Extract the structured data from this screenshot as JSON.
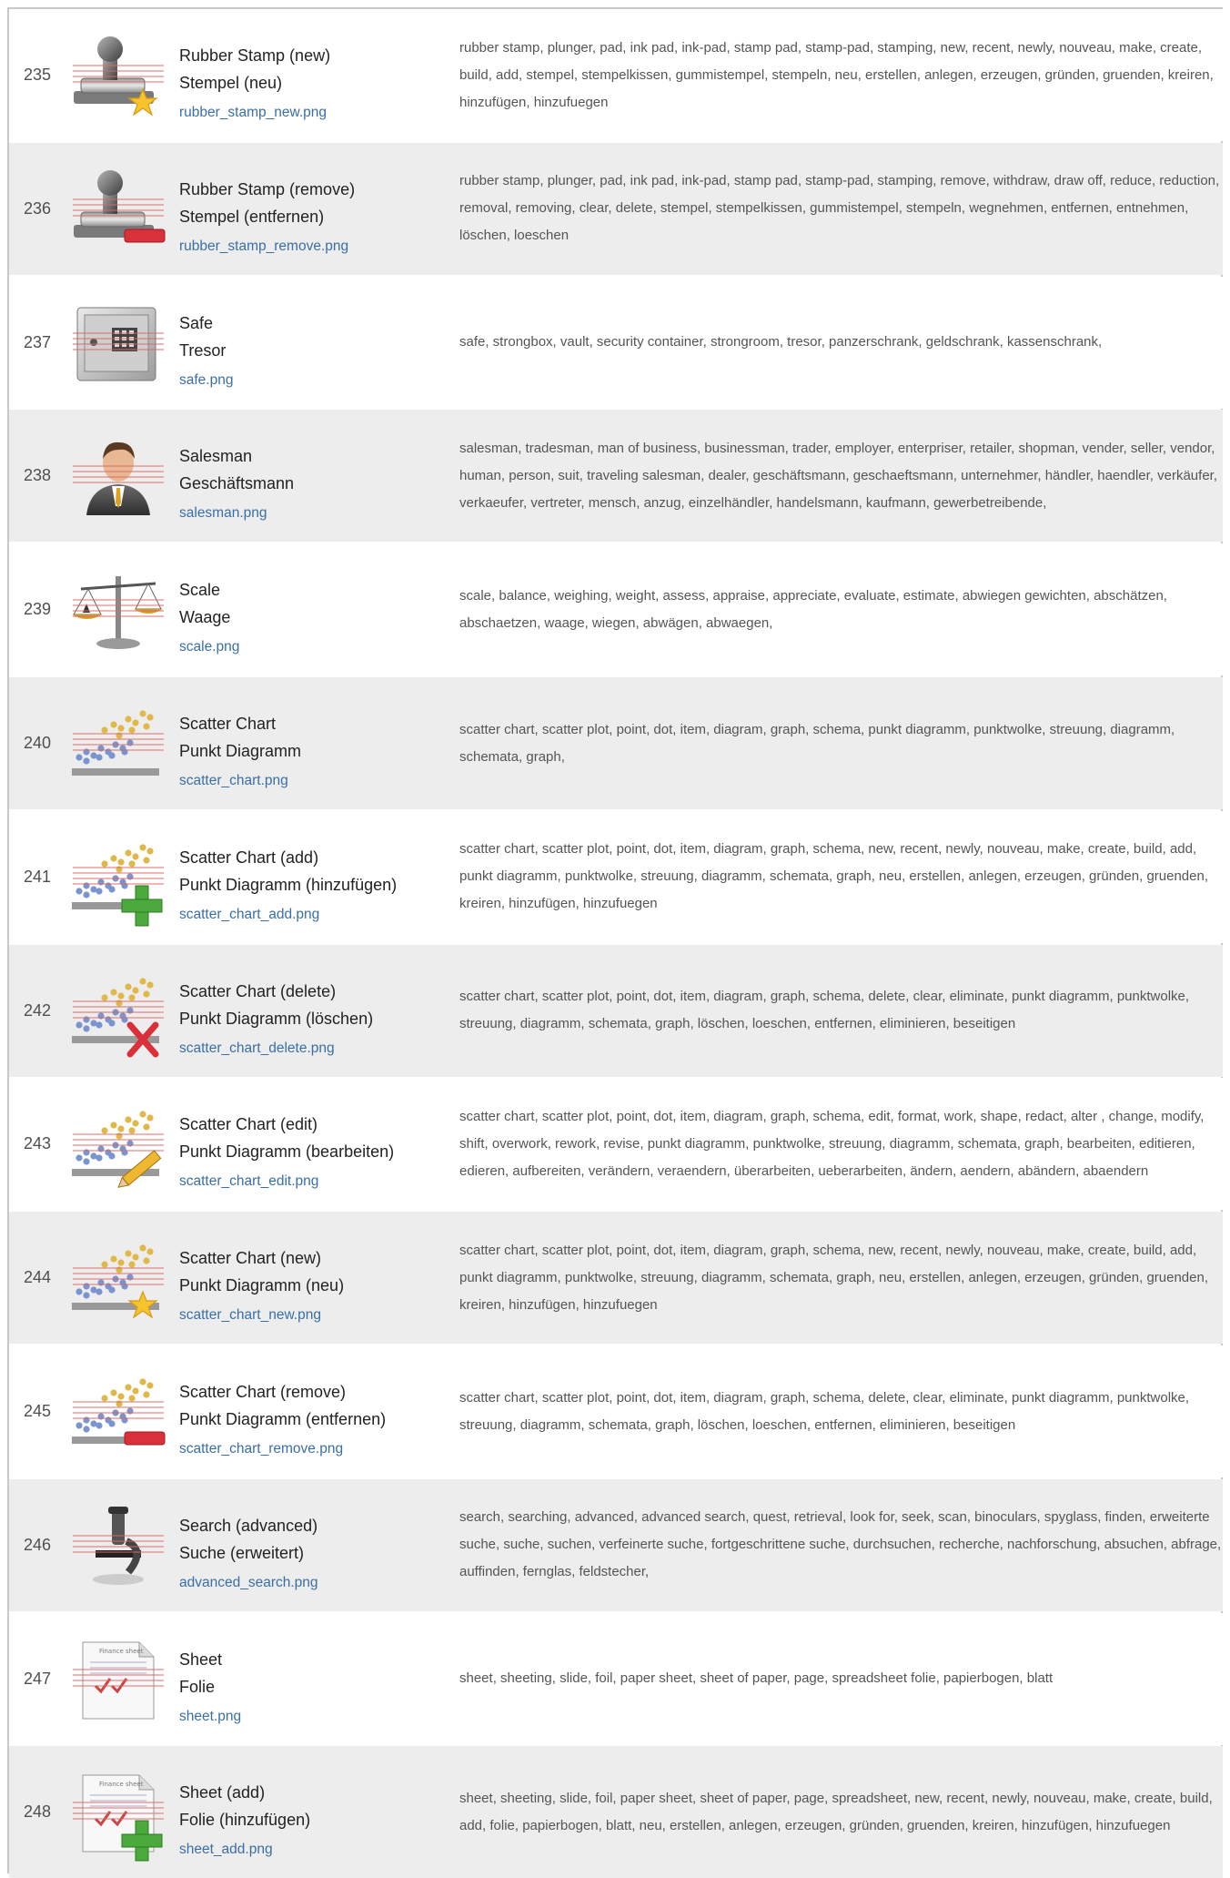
{
  "rows": [
    {
      "num": "235",
      "icon": "rubber-stamp-new-icon",
      "name_en": "Rubber Stamp (new)",
      "name_de": "Stempel (neu)",
      "file": "rubber_stamp_new.png",
      "keywords": "rubber stamp, plunger, pad, ink pad, ink-pad, stamp pad, stamp-pad, stamping, new, recent, newly, nouveau, make, create, build, add, stempel, stempelkissen, gummistempel, stempeln, neu, erstellen, anlegen, erzeugen, gründen, gruenden, kreiren, hinzufügen, hinzufuegen"
    },
    {
      "num": "236",
      "icon": "rubber-stamp-remove-icon",
      "name_en": "Rubber Stamp (remove)",
      "name_de": "Stempel (entfernen)",
      "file": "rubber_stamp_remove.png",
      "keywords": "rubber stamp, plunger, pad, ink pad, ink-pad, stamp pad, stamp-pad, stamping, remove, withdraw, draw off, reduce, reduction, removal, removing, clear, delete, stempel, stempelkissen, gummistempel, stempeln, wegnehmen, entfernen, entnehmen, löschen, loeschen"
    },
    {
      "num": "237",
      "icon": "safe-icon",
      "name_en": "Safe",
      "name_de": "Tresor",
      "file": "safe.png",
      "keywords": "safe, strongbox, vault, security container, strongroom, tresor, panzerschrank, geldschrank, kassenschrank,"
    },
    {
      "num": "238",
      "icon": "salesman-icon",
      "name_en": "Salesman",
      "name_de": "Geschäftsmann",
      "file": "salesman.png",
      "keywords": "salesman, tradesman, man of business, businessman, trader, employer, enterpriser, retailer, shopman, vender, seller, vendor, human, person, suit, traveling salesman, dealer, geschäftsmann, geschaeftsmann, unternehmer, händler, haendler, verkäufer, verkaeufer, vertreter, mensch, anzug, einzelhändler, handelsmann, kaufmann, gewerbetreibende,"
    },
    {
      "num": "239",
      "icon": "scale-icon",
      "name_en": "Scale",
      "name_de": "Waage",
      "file": "scale.png",
      "keywords": "scale, balance, weighing, weight, assess, appraise, appreciate, evaluate, estimate, abwiegen gewichten, abschätzen, abschaetzen, waage, wiegen, abwägen, abwaegen,"
    },
    {
      "num": "240",
      "icon": "scatter-chart-icon",
      "name_en": "Scatter Chart",
      "name_de": "Punkt Diagramm",
      "file": "scatter_chart.png",
      "keywords": "scatter chart, scatter plot, point, dot, item, diagram, graph, schema, punkt diagramm, punktwolke, streuung, diagramm, schemata, graph,"
    },
    {
      "num": "241",
      "icon": "scatter-chart-add-icon",
      "name_en": "Scatter Chart (add)",
      "name_de": "Punkt Diagramm (hinzufügen)",
      "file": "scatter_chart_add.png",
      "keywords": "scatter chart, scatter plot, point, dot, item, diagram, graph, schema, new, recent, newly, nouveau, make, create, build, add, punkt diagramm, punktwolke, streuung, diagramm, schemata, graph, neu, erstellen, anlegen, erzeugen, gründen, gruenden, kreiren, hinzufügen, hinzufuegen"
    },
    {
      "num": "242",
      "icon": "scatter-chart-delete-icon",
      "name_en": "Scatter Chart (delete)",
      "name_de": "Punkt Diagramm (löschen)",
      "file": "scatter_chart_delete.png",
      "keywords": "scatter chart, scatter plot, point, dot, item, diagram, graph, schema, delete, clear, eliminate, punkt diagramm, punktwolke, streuung, diagramm, schemata, graph, löschen, loeschen, entfernen, eliminieren, beseitigen"
    },
    {
      "num": "243",
      "icon": "scatter-chart-edit-icon",
      "name_en": "Scatter Chart (edit)",
      "name_de": "Punkt Diagramm (bearbeiten)",
      "file": "scatter_chart_edit.png",
      "keywords": "scatter chart, scatter plot, point, dot, item, diagram, graph, schema, edit, format, work, shape, redact, alter , change, modify, shift, overwork, rework, revise, punkt diagramm, punktwolke, streuung, diagramm, schemata, graph, bearbeiten, editieren, edieren, aufbereiten, verändern, veraendern, überarbeiten, ueberarbeiten, ändern, aendern, abändern, abaendern"
    },
    {
      "num": "244",
      "icon": "scatter-chart-new-icon",
      "name_en": "Scatter Chart (new)",
      "name_de": "Punkt Diagramm (neu)",
      "file": "scatter_chart_new.png",
      "keywords": "scatter chart, scatter plot, point, dot, item, diagram, graph, schema, new, recent, newly, nouveau, make, create, build, add, punkt diagramm, punktwolke, streuung, diagramm, schemata, graph, neu, erstellen, anlegen, erzeugen, gründen, gruenden, kreiren, hinzufügen, hinzufuegen"
    },
    {
      "num": "245",
      "icon": "scatter-chart-remove-icon",
      "name_en": "Scatter Chart (remove)",
      "name_de": "Punkt Diagramm (entfernen)",
      "file": "scatter_chart_remove.png",
      "keywords": "scatter chart, scatter plot, point, dot, item, diagram, graph, schema, delete, clear, eliminate, punkt diagramm, punktwolke, streuung, diagramm, schemata, graph, löschen, loeschen, entfernen, eliminieren, beseitigen"
    },
    {
      "num": "246",
      "icon": "microscope-icon",
      "name_en": "Search (advanced)",
      "name_de": "Suche (erweitert)",
      "file": "advanced_search.png",
      "keywords": "search, searching, advanced, advanced search, quest, retrieval, look for, seek, scan, binoculars, spyglass, finden, erweiterte suche, suche, suchen, verfeinerte suche, fortgeschrittene suche, durchsuchen, recherche, nachforschung, absuchen, abfrage, auffinden, fernglas, feldstecher,"
    },
    {
      "num": "247",
      "icon": "sheet-icon",
      "name_en": "Sheet",
      "name_de": "Folie",
      "file": "sheet.png",
      "keywords": "sheet, sheeting, slide, foil, paper sheet, sheet of paper, page, spreadsheet folie, papierbogen, blatt"
    },
    {
      "num": "248",
      "icon": "sheet-add-icon",
      "name_en": "Sheet (add)",
      "name_de": "Folie (hinzufügen)",
      "file": "sheet_add.png",
      "keywords": "sheet, sheeting, slide, foil, paper sheet, sheet of paper, page, spreadsheet, new, recent, newly, nouveau, make, create, build, add, folie, papierbogen, blatt, neu, erstellen, anlegen, erzeugen, gründen, gruenden, kreiren, hinzufügen, hinzufuegen"
    }
  ],
  "sheet_label": "Finance sheet"
}
